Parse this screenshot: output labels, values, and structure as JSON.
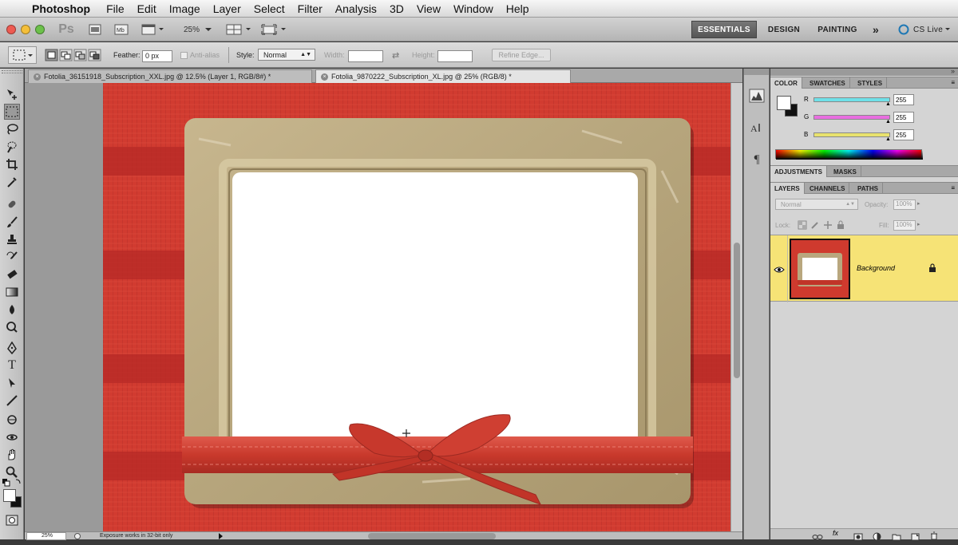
{
  "menubar": {
    "app_name": "Photoshop",
    "items": [
      "File",
      "Edit",
      "Image",
      "Layer",
      "Select",
      "Filter",
      "Analysis",
      "3D",
      "View",
      "Window",
      "Help"
    ]
  },
  "appbar": {
    "ps_logo": "Ps",
    "zoom": "25%",
    "workspaces": [
      "ESSENTIALS",
      "DESIGN",
      "PAINTING"
    ],
    "more": "»",
    "cs_live": "CS Live"
  },
  "options": {
    "feather_label": "Feather:",
    "feather_value": "0 px",
    "anti_alias": "Anti-alias",
    "style_label": "Style:",
    "style_value": "Normal",
    "width_label": "Width:",
    "height_label": "Height:",
    "refine_edge": "Refine Edge..."
  },
  "tabs": [
    {
      "label": "Fotolia_36151918_Subscription_XXL.jpg @ 12.5% (Layer 1, RGB/8#) *",
      "active": false
    },
    {
      "label": "Fotolia_9870222_Subscription_XL.jpg @ 25% (RGB/8) *",
      "active": true
    }
  ],
  "status": {
    "zoom": "25%",
    "message": "Exposure works in 32-bit only"
  },
  "color_panel": {
    "tabs": [
      "COLOR",
      "SWATCHES",
      "STYLES"
    ],
    "channels": [
      {
        "label": "R",
        "value": "255",
        "color": "#6ee0e8"
      },
      {
        "label": "G",
        "value": "255",
        "color": "#e86ee0"
      },
      {
        "label": "B",
        "value": "255",
        "color": "#e8e26e"
      }
    ]
  },
  "adjustments_panel": {
    "tabs": [
      "ADJUSTMENTS",
      "MASKS"
    ]
  },
  "layers_panel": {
    "tabs": [
      "LAYERS",
      "CHANNELS",
      "PATHS"
    ],
    "blend_mode": "Normal",
    "opacity_label": "Opacity:",
    "opacity_value": "100%",
    "lock_label": "Lock:",
    "fill_label": "Fill:",
    "fill_value": "100%",
    "layers": [
      {
        "name": "Background",
        "selected": true,
        "locked": true
      }
    ]
  }
}
